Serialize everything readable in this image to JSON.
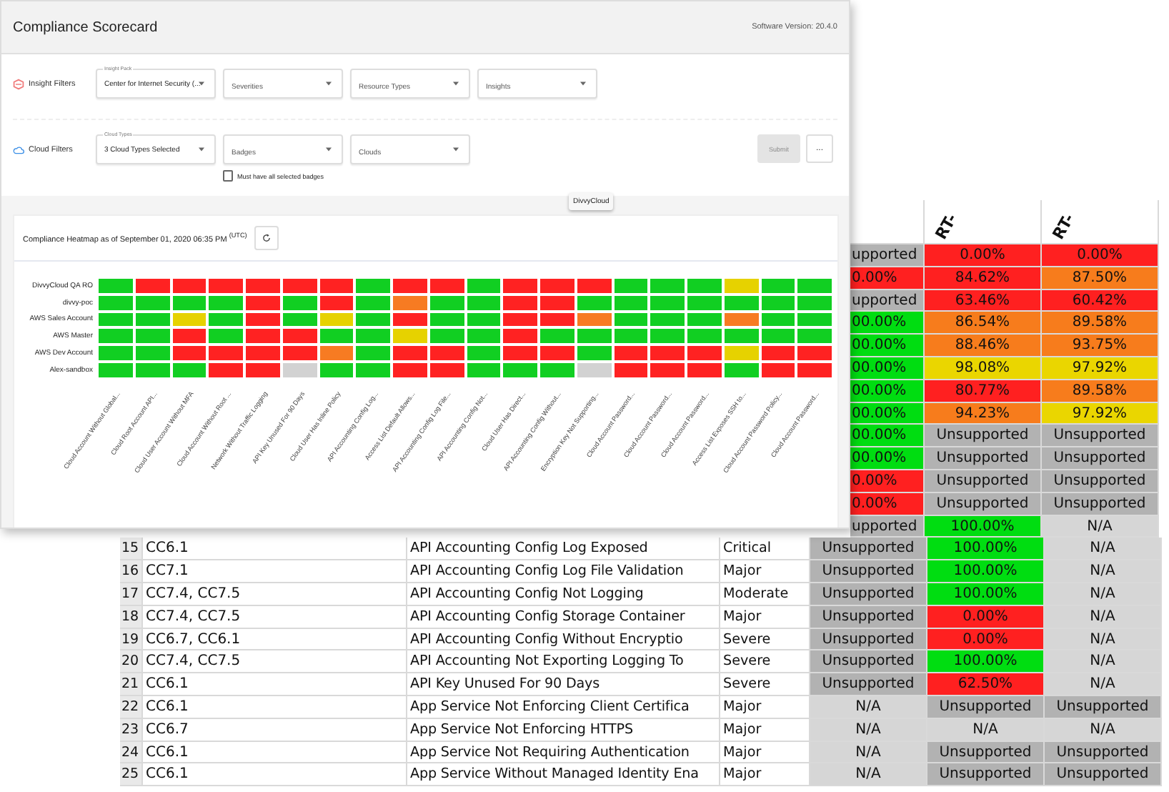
{
  "spreadsheet": {
    "header": [
      {
        "text": "RT-"
      },
      {
        "text": "RT-"
      }
    ],
    "upper_rows": [
      {
        "cells": [
          {
            "text": "upported",
            "color": "#b2b2b2"
          },
          {
            "text": "0.00%",
            "color": "#ff2020"
          },
          {
            "text": "0.00%",
            "color": "#ff2020"
          }
        ]
      },
      {
        "cells": [
          {
            "text": "0.00%",
            "color": "#ff2020"
          },
          {
            "text": "84.62%",
            "color": "#ff2020"
          },
          {
            "text": "87.50%",
            "color": "#f77c1c"
          }
        ]
      },
      {
        "cells": [
          {
            "text": "upported",
            "color": "#b2b2b2"
          },
          {
            "text": "63.46%",
            "color": "#ff2020"
          },
          {
            "text": "60.42%",
            "color": "#ff2020"
          }
        ]
      },
      {
        "cells": [
          {
            "text": "00.00%",
            "color": "#00dd11"
          },
          {
            "text": "86.54%",
            "color": "#f77c1c"
          },
          {
            "text": "89.58%",
            "color": "#f77c1c"
          }
        ]
      },
      {
        "cells": [
          {
            "text": "00.00%",
            "color": "#00dd11"
          },
          {
            "text": "88.46%",
            "color": "#f77c1c"
          },
          {
            "text": "93.75%",
            "color": "#f77c1c"
          }
        ]
      },
      {
        "cells": [
          {
            "text": "00.00%",
            "color": "#00dd11"
          },
          {
            "text": "98.08%",
            "color": "#ead600"
          },
          {
            "text": "97.92%",
            "color": "#ead600"
          }
        ]
      },
      {
        "cells": [
          {
            "text": "00.00%",
            "color": "#00dd11"
          },
          {
            "text": "80.77%",
            "color": "#ff2020"
          },
          {
            "text": "89.58%",
            "color": "#f77c1c"
          }
        ]
      },
      {
        "cells": [
          {
            "text": "00.00%",
            "color": "#00dd11"
          },
          {
            "text": "94.23%",
            "color": "#f77c1c"
          },
          {
            "text": "97.92%",
            "color": "#ead600"
          }
        ]
      },
      {
        "cells": [
          {
            "text": "00.00%",
            "color": "#00dd11"
          },
          {
            "text": "Unsupported",
            "color": "#b2b2b2"
          },
          {
            "text": "Unsupported",
            "color": "#b2b2b2"
          }
        ]
      },
      {
        "cells": [
          {
            "text": "00.00%",
            "color": "#00dd11"
          },
          {
            "text": "Unsupported",
            "color": "#b2b2b2"
          },
          {
            "text": "Unsupported",
            "color": "#b2b2b2"
          }
        ]
      },
      {
        "cells": [
          {
            "text": "0.00%",
            "color": "#ff2020"
          },
          {
            "text": "Unsupported",
            "color": "#b2b2b2"
          },
          {
            "text": "Unsupported",
            "color": "#b2b2b2"
          }
        ]
      },
      {
        "cells": [
          {
            "text": "0.00%",
            "color": "#ff2020"
          },
          {
            "text": "Unsupported",
            "color": "#b2b2b2"
          },
          {
            "text": "Unsupported",
            "color": "#b2b2b2"
          }
        ]
      },
      {
        "cells": [
          {
            "text": "upported",
            "color": "#b2b2b2"
          },
          {
            "text": "100.00%",
            "color": "#00dd11"
          },
          {
            "text": "N/A",
            "color": "#d6d6d6"
          }
        ]
      }
    ],
    "rows": [
      {
        "number": "15",
        "control": "CC6.1",
        "insight": "API Accounting Config Log Exposed",
        "severity": "Critical",
        "cells": [
          {
            "text": "Unsupported",
            "color": "#b2b2b2"
          },
          {
            "text": "100.00%",
            "color": "#00dd11"
          },
          {
            "text": "N/A",
            "color": "#d6d6d6"
          }
        ]
      },
      {
        "number": "16",
        "control": "CC7.1",
        "insight": "API Accounting Config Log File Validation",
        "severity": "Major",
        "cells": [
          {
            "text": "Unsupported",
            "color": "#b2b2b2"
          },
          {
            "text": "100.00%",
            "color": "#00dd11"
          },
          {
            "text": "N/A",
            "color": "#d6d6d6"
          }
        ]
      },
      {
        "number": "17",
        "control": "CC7.4, CC7.5",
        "insight": "API Accounting Config Not Logging",
        "severity": "Moderate",
        "cells": [
          {
            "text": "Unsupported",
            "color": "#b2b2b2"
          },
          {
            "text": "100.00%",
            "color": "#00dd11"
          },
          {
            "text": "N/A",
            "color": "#d6d6d6"
          }
        ]
      },
      {
        "number": "18",
        "control": "CC7.4, CC7.5",
        "insight": "API Accounting Config Storage Container",
        "severity": "Major",
        "cells": [
          {
            "text": "Unsupported",
            "color": "#b2b2b2"
          },
          {
            "text": "0.00%",
            "color": "#ff2020"
          },
          {
            "text": "N/A",
            "color": "#d6d6d6"
          }
        ]
      },
      {
        "number": "19",
        "control": "CC6.7, CC6.1",
        "insight": "API Accounting Config Without Encryptio",
        "severity": "Severe",
        "cells": [
          {
            "text": "Unsupported",
            "color": "#b2b2b2"
          },
          {
            "text": "0.00%",
            "color": "#ff2020"
          },
          {
            "text": "N/A",
            "color": "#d6d6d6"
          }
        ]
      },
      {
        "number": "20",
        "control": "CC7.4, CC7.5",
        "insight": "API Accounting Not Exporting Logging To",
        "severity": "Severe",
        "cells": [
          {
            "text": "Unsupported",
            "color": "#b2b2b2"
          },
          {
            "text": "100.00%",
            "color": "#00dd11"
          },
          {
            "text": "N/A",
            "color": "#d6d6d6"
          }
        ]
      },
      {
        "number": "21",
        "control": "CC6.1",
        "insight": "API Key Unused For 90 Days",
        "severity": "Severe",
        "cells": [
          {
            "text": "Unsupported",
            "color": "#b2b2b2"
          },
          {
            "text": "62.50%",
            "color": "#ff2020"
          },
          {
            "text": "N/A",
            "color": "#d6d6d6"
          }
        ]
      },
      {
        "number": "22",
        "control": "CC6.1",
        "insight": "App Service Not Enforcing Client Certifica",
        "severity": "Major",
        "cells": [
          {
            "text": "N/A",
            "color": "#d6d6d6"
          },
          {
            "text": "Unsupported",
            "color": "#b2b2b2"
          },
          {
            "text": "Unsupported",
            "color": "#b2b2b2"
          }
        ]
      },
      {
        "number": "23",
        "control": "CC6.7",
        "insight": "App Service Not Enforcing HTTPS",
        "severity": "Major",
        "cells": [
          {
            "text": "N/A",
            "color": "#d6d6d6"
          },
          {
            "text": "N/A",
            "color": "#d6d6d6"
          },
          {
            "text": "N/A",
            "color": "#d6d6d6"
          }
        ]
      },
      {
        "number": "24",
        "control": "CC6.1",
        "insight": "App Service Not Requiring Authentication",
        "severity": "Major",
        "cells": [
          {
            "text": "N/A",
            "color": "#d6d6d6"
          },
          {
            "text": "Unsupported",
            "color": "#b2b2b2"
          },
          {
            "text": "Unsupported",
            "color": "#b2b2b2"
          }
        ]
      },
      {
        "number": "25",
        "control": "CC6.1",
        "insight": "App Service Without Managed Identity Ena",
        "severity": "Major",
        "cells": [
          {
            "text": "N/A",
            "color": "#d6d6d6"
          },
          {
            "text": "Unsupported",
            "color": "#b2b2b2"
          },
          {
            "text": "Unsupported",
            "color": "#b2b2b2"
          }
        ]
      }
    ]
  },
  "app": {
    "title": "Compliance Scorecard",
    "version": "Software Version: 20.4.0",
    "filter_groups": [
      {
        "kind": "insight",
        "label": "Insight Filters",
        "dropdowns": [
          {
            "label": "Insight Pack",
            "value": "Center for Internet Security (..."
          },
          {
            "placeholder": "Severities"
          },
          {
            "placeholder": "Resource Types"
          },
          {
            "placeholder": "Insights"
          }
        ]
      },
      {
        "kind": "cloud",
        "label": "Cloud Filters",
        "dropdowns": [
          {
            "label": "Cloud Types",
            "value": "3 Cloud Types Selected"
          },
          {
            "placeholder": "Badges"
          },
          {
            "placeholder": "Clouds"
          }
        ],
        "checkbox": {
          "label": "Must have all selected badges",
          "checked": false
        }
      }
    ],
    "tooltip": "DivvyCloud",
    "submit": {
      "label": "Submit",
      "disabled": true
    },
    "more_button": "...",
    "heatmap": {
      "title": "Compliance Heatmap as of September 01, 2020 06:35 PM $^{(UTC)}$",
      "rows": [
        {
          "label": "DivvyCloud QA RO",
          "cells": [
            {
              "color": "#11cf22"
            },
            {
              "color": "#ff2222"
            },
            {
              "color": "#ff2222"
            },
            {
              "color": "#ff2222"
            },
            {
              "color": "#ff2222"
            },
            {
              "color": "#ff2222"
            },
            {
              "color": "#ff2222"
            },
            {
              "color": "#11cf22"
            },
            {
              "color": "#ff2222"
            },
            {
              "color": "#ff2222"
            },
            {
              "color": "#11cf22"
            },
            {
              "color": "#ff2222"
            },
            {
              "color": "#ff2222"
            },
            {
              "color": "#ff2222"
            },
            {
              "color": "#11cf22"
            },
            {
              "color": "#11cf22"
            },
            {
              "color": "#11cf22"
            },
            {
              "color": "#e6d200"
            },
            {
              "color": "#11cf22"
            },
            {
              "color": "#11cf22"
            }
          ]
        },
        {
          "label": "divvy-poc",
          "cells": [
            {
              "color": "#11cf22"
            },
            {
              "color": "#11cf22"
            },
            {
              "color": "#11cf22"
            },
            {
              "color": "#11cf22"
            },
            {
              "color": "#ff2222"
            },
            {
              "color": "#11cf22"
            },
            {
              "color": "#ff2222"
            },
            {
              "color": "#11cf22"
            },
            {
              "color": "#f77b22"
            },
            {
              "color": "#11cf22"
            },
            {
              "color": "#11cf22"
            },
            {
              "color": "#ff2222"
            },
            {
              "color": "#ff2222"
            },
            {
              "color": "#11cf22"
            },
            {
              "color": "#11cf22"
            },
            {
              "color": "#11cf22"
            },
            {
              "color": "#11cf22"
            },
            {
              "color": "#11cf22"
            },
            {
              "color": "#11cf22"
            },
            {
              "color": "#11cf22"
            }
          ]
        },
        {
          "label": "AWS Sales Account",
          "cells": [
            {
              "color": "#11cf22"
            },
            {
              "color": "#11cf22"
            },
            {
              "color": "#e6d200"
            },
            {
              "color": "#11cf22"
            },
            {
              "color": "#ff2222"
            },
            {
              "color": "#11cf22"
            },
            {
              "color": "#e6d200"
            },
            {
              "color": "#11cf22"
            },
            {
              "color": "#ff2222"
            },
            {
              "color": "#11cf22"
            },
            {
              "color": "#11cf22"
            },
            {
              "color": "#ff2222"
            },
            {
              "color": "#ff2222"
            },
            {
              "color": "#f77b22"
            },
            {
              "color": "#11cf22"
            },
            {
              "color": "#11cf22"
            },
            {
              "color": "#11cf22"
            },
            {
              "color": "#f77b22"
            },
            {
              "color": "#11cf22"
            },
            {
              "color": "#11cf22"
            }
          ]
        },
        {
          "label": "AWS Master",
          "cells": [
            {
              "color": "#11cf22"
            },
            {
              "color": "#11cf22"
            },
            {
              "color": "#ff2222"
            },
            {
              "color": "#11cf22"
            },
            {
              "color": "#ff2222"
            },
            {
              "color": "#ff2222"
            },
            {
              "color": "#11cf22"
            },
            {
              "color": "#11cf22"
            },
            {
              "color": "#e6d200"
            },
            {
              "color": "#11cf22"
            },
            {
              "color": "#11cf22"
            },
            {
              "color": "#ff2222"
            },
            {
              "color": "#11cf22"
            },
            {
              "color": "#11cf22"
            },
            {
              "color": "#11cf22"
            },
            {
              "color": "#11cf22"
            },
            {
              "color": "#11cf22"
            },
            {
              "color": "#11cf22"
            },
            {
              "color": "#11cf22"
            },
            {
              "color": "#11cf22"
            }
          ]
        },
        {
          "label": "AWS Dev Account",
          "cells": [
            {
              "color": "#11cf22"
            },
            {
              "color": "#11cf22"
            },
            {
              "color": "#ff2222"
            },
            {
              "color": "#ff2222"
            },
            {
              "color": "#ff2222"
            },
            {
              "color": "#ff2222"
            },
            {
              "color": "#f77b22"
            },
            {
              "color": "#11cf22"
            },
            {
              "color": "#ff2222"
            },
            {
              "color": "#ff2222"
            },
            {
              "color": "#11cf22"
            },
            {
              "color": "#ff2222"
            },
            {
              "color": "#ff2222"
            },
            {
              "color": "#11cf22"
            },
            {
              "color": "#ff2222"
            },
            {
              "color": "#ff2222"
            },
            {
              "color": "#ff2222"
            },
            {
              "color": "#e6d200"
            },
            {
              "color": "#ff2222"
            },
            {
              "color": "#ff2222"
            }
          ]
        },
        {
          "label": "Alex-sandbox",
          "cells": [
            {
              "color": "#11cf22"
            },
            {
              "color": "#11cf22"
            },
            {
              "color": "#11cf22"
            },
            {
              "color": "#ff2222"
            },
            {
              "color": "#ff2222"
            },
            {
              "color": "#d2d2d2"
            },
            {
              "color": "#11cf22"
            },
            {
              "color": "#11cf22"
            },
            {
              "color": "#ff2222"
            },
            {
              "color": "#ff2222"
            },
            {
              "color": "#11cf22"
            },
            {
              "color": "#11cf22"
            },
            {
              "color": "#11cf22"
            },
            {
              "color": "#d2d2d2"
            },
            {
              "color": "#ff2222"
            },
            {
              "color": "#ff2222"
            },
            {
              "color": "#ff2222"
            },
            {
              "color": "#11cf22"
            },
            {
              "color": "#ff2222"
            },
            {
              "color": "#ff2222"
            }
          ]
        }
      ],
      "columns": [
        "Cloud Account Without Global...",
        "Cloud Root Account API...",
        "Cloud User Account Without MFA",
        "Cloud Account Without Root ...",
        "Network Without Traffic Logging",
        "API Key Unused For 90 Days",
        "Cloud User Has Inline Policy",
        "API Accounting Config Log...",
        "Access List Default Allows...",
        "API Accounting Config Log File...",
        "API Accounting Config Not...",
        "Cloud User Has Direct...",
        "API Accounting Config Without...",
        "Encryption Key Not Supporting...",
        "Cloud Account Password...",
        "Cloud Account Password...",
        "Cloud Account Password...",
        "Access List Exposes SSH to...",
        "Cloud Account Password Policy...",
        "Cloud Account Password..."
      ]
    }
  }
}
